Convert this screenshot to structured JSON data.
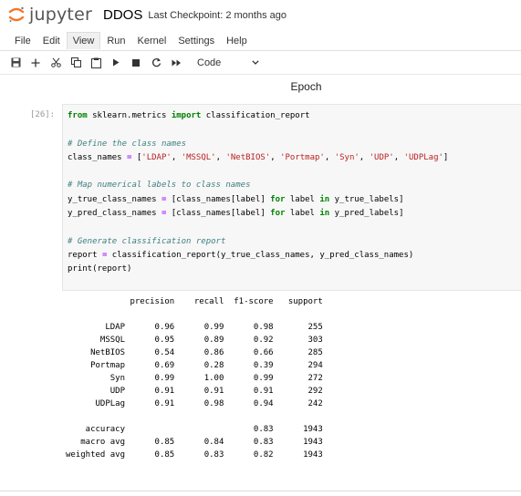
{
  "header": {
    "logo_text": "jupyter",
    "notebook_name": "DDOS",
    "checkpoint": "Last Checkpoint: 2 months ago"
  },
  "menu": [
    "File",
    "Edit",
    "View",
    "Run",
    "Kernel",
    "Settings",
    "Help"
  ],
  "toolbar": {
    "cell_type": "Code",
    "icons": [
      "save-icon",
      "add-icon",
      "cut-icon",
      "copy-icon",
      "paste-icon",
      "run-icon",
      "stop-icon",
      "restart-icon",
      "fast-forward-icon"
    ]
  },
  "heading": "Epoch",
  "cell": {
    "prompt": "[26]:",
    "code_lines": [
      "from sklearn.metrics import classification_report",
      "",
      "# Define the class names",
      "class_names = ['LDAP', 'MSSQL', 'NetBIOS', 'Portmap', 'Syn', 'UDP', 'UDPLag']",
      "",
      "# Map numerical labels to class names",
      "y_true_class_names = [class_names[label] for label in y_true_labels]",
      "y_pred_class_names = [class_names[label] for label in y_pred_labels]",
      "",
      "# Generate classification report",
      "report = classification_report(y_true_class_names, y_pred_class_names)",
      "print(report)"
    ]
  },
  "report": {
    "columns": [
      "precision",
      "recall",
      "f1-score",
      "support"
    ],
    "rows": [
      {
        "label": "LDAP",
        "precision": "0.96",
        "recall": "0.99",
        "f1": "0.98",
        "support": "255"
      },
      {
        "label": "MSSQL",
        "precision": "0.95",
        "recall": "0.89",
        "f1": "0.92",
        "support": "303"
      },
      {
        "label": "NetBIOS",
        "precision": "0.54",
        "recall": "0.86",
        "f1": "0.66",
        "support": "285"
      },
      {
        "label": "Portmap",
        "precision": "0.69",
        "recall": "0.28",
        "f1": "0.39",
        "support": "294"
      },
      {
        "label": "Syn",
        "precision": "0.99",
        "recall": "1.00",
        "f1": "0.99",
        "support": "272"
      },
      {
        "label": "UDP",
        "precision": "0.91",
        "recall": "0.91",
        "f1": "0.91",
        "support": "292"
      },
      {
        "label": "UDPLag",
        "precision": "0.91",
        "recall": "0.98",
        "f1": "0.94",
        "support": "242"
      }
    ],
    "summary": [
      {
        "label": "accuracy",
        "precision": "",
        "recall": "",
        "f1": "0.83",
        "support": "1943"
      },
      {
        "label": "macro avg",
        "precision": "0.85",
        "recall": "0.84",
        "f1": "0.83",
        "support": "1943"
      },
      {
        "label": "weighted avg",
        "precision": "0.85",
        "recall": "0.83",
        "f1": "0.82",
        "support": "1943"
      }
    ]
  },
  "colors": {
    "logo_orange": "#f37626",
    "keyword": "#008000",
    "comment": "#408080",
    "string": "#ba2121",
    "operator": "#aa22ff"
  }
}
